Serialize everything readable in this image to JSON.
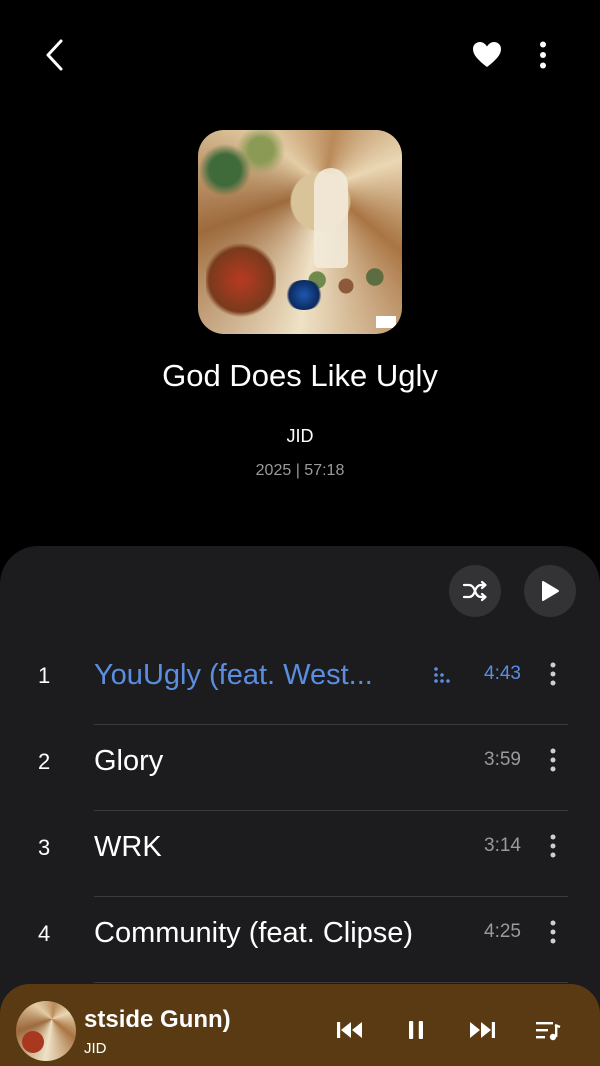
{
  "topbar": {
    "icons": [
      "back-arrow-icon",
      "heart-icon",
      "more-vertical-icon"
    ]
  },
  "album": {
    "title": "God Does Like Ugly",
    "artist": "JID",
    "meta": "2025 | 57:18"
  },
  "tracklist": {
    "actions": [
      "shuffle-icon",
      "play-icon"
    ],
    "tracks": [
      {
        "num": "1",
        "title": "YouUgly (feat. West...",
        "duration": "4:43",
        "playing": true
      },
      {
        "num": "2",
        "title": "Glory",
        "duration": "3:59"
      },
      {
        "num": "3",
        "title": "WRK",
        "duration": "3:14"
      },
      {
        "num": "4",
        "title": "Community (feat. Clipse)",
        "duration": "4:25"
      }
    ]
  },
  "mini_player": {
    "title": "stside Gunn)",
    "artist": "JID",
    "controls": [
      "previous-icon",
      "pause-icon",
      "next-icon",
      "queue-icon"
    ]
  },
  "colors": {
    "accent": "#5b8de0",
    "mini_player_bg": "#5a3a12",
    "panel_bg": "#1c1c1e"
  }
}
